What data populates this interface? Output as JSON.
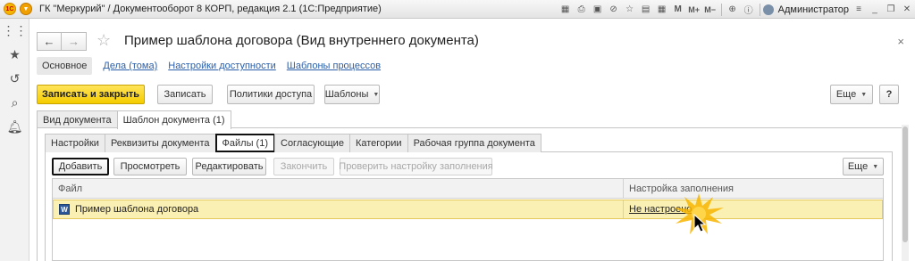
{
  "window": {
    "title": "ГК \"Меркурий\" / Документооборот 8 КОРП, редакция 2.1  (1С:Предприятие)",
    "logo_text": "1С",
    "user": "Администратор",
    "icons": [
      "grid-icon",
      "print-icon",
      "save-icon",
      "link-icon",
      "star-icon",
      "table-icon",
      "calendar-icon",
      "M-icon",
      "M+-icon",
      "M--icon",
      "zoom-icon",
      "info-icon"
    ]
  },
  "left_panel": {
    "icons": [
      "apps-icon",
      "favorites-star-icon",
      "history-icon",
      "search-icon",
      "notifications-bell-icon"
    ]
  },
  "form": {
    "title": "Пример шаблона договора (Вид внутреннего документа)",
    "close": "×",
    "sections": {
      "active": "Основное",
      "links": [
        "Дела (тома)",
        "Настройки доступности",
        "Шаблоны процессов"
      ]
    },
    "toolbar": {
      "save_close": "Записать и закрыть",
      "save": "Записать",
      "access_policies": "Политики доступа",
      "templates": "Шаблоны",
      "more": "Еще",
      "help": "?"
    },
    "outer_tabs": [
      "Вид документа",
      "Шаблон документа (1)"
    ],
    "inner_tabs": [
      "Настройки",
      "Реквизиты документа",
      "Файлы (1)",
      "Согласующие",
      "Категории",
      "Рабочая группа документа"
    ],
    "files_toolbar": {
      "add": "Добавить",
      "view": "Просмотреть",
      "edit": "Редактировать",
      "finish": "Закончить",
      "check_fill": "Проверить настройку заполнения",
      "more": "Еще"
    },
    "grid": {
      "headers": [
        "Файл",
        "Настройка заполнения"
      ],
      "rows": [
        {
          "file": "Пример шаблона договора",
          "fill": "Не настроено",
          "icon": "W"
        }
      ]
    }
  },
  "colors": {
    "primary_button": "#f5cc00",
    "link": "#2a5ea8",
    "selected_row": "#fbf0b4"
  }
}
